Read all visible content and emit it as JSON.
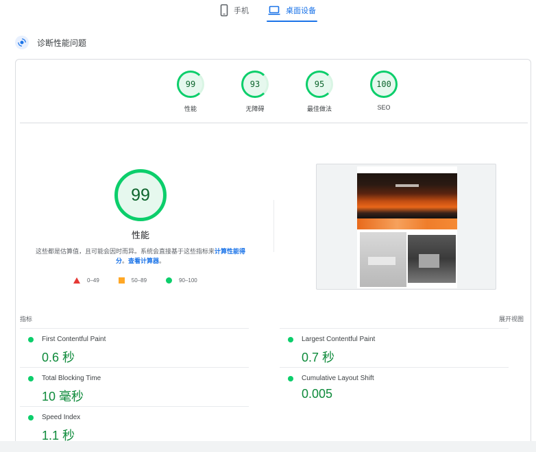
{
  "tabs": [
    {
      "label": "手机",
      "icon": "phone-icon",
      "active": false
    },
    {
      "label": "桌面设备",
      "icon": "laptop-icon",
      "active": true
    }
  ],
  "diagnose": {
    "title": "诊断性能问题",
    "icon": "diagnose-icon"
  },
  "gauges": [
    {
      "score": "99",
      "label": "性能"
    },
    {
      "score": "93",
      "label": "无障碍"
    },
    {
      "score": "95",
      "label": "最佳做法"
    },
    {
      "score": "100",
      "label": "SEO"
    }
  ],
  "performance": {
    "score": "99",
    "label": "性能",
    "desc_prefix": "这些都是估算值，且可能会因时而异。系统会直接基于这些指标来",
    "link1": "计算性能得分",
    "desc_mid": "。",
    "link2": "查看计算器",
    "desc_suffix": "。"
  },
  "legend": [
    {
      "range": "0–49",
      "shape": "triangle",
      "color": "#e53935"
    },
    {
      "range": "50–89",
      "shape": "square",
      "color": "#ffa726"
    },
    {
      "range": "90–100",
      "shape": "circle",
      "color": "#0cce6b"
    }
  ],
  "metrics_header": {
    "title": "指标",
    "expand": "展开视图"
  },
  "metrics": [
    {
      "name": "First Contentful Paint",
      "value": "0.6 秒"
    },
    {
      "name": "Largest Contentful Paint",
      "value": "0.7 秒"
    },
    {
      "name": "Total Blocking Time",
      "value": "10 毫秒"
    },
    {
      "name": "Cumulative Layout Shift",
      "value": "0.005"
    },
    {
      "name": "Speed Index",
      "value": "1.1 秒"
    }
  ],
  "colors": {
    "accent": "#1a73e8",
    "pass": "#0cce6b",
    "pass_text": "#0d8a3a"
  }
}
